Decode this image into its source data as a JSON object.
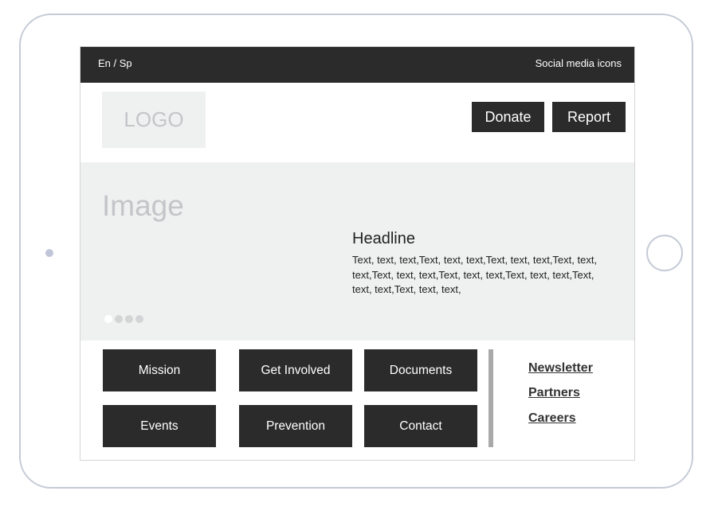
{
  "topbar": {
    "language": "En / Sp",
    "social": "Social media icons"
  },
  "header": {
    "logo": "LOGO",
    "donate_label": "Donate",
    "report_label": "Report"
  },
  "hero": {
    "image_label": "Image",
    "headline": "Headline",
    "body": "Text, text, text,Text, text, text,Text, text, text,Text, text, text,Text, text, text,Text, text, text,Text, text, text,Text, text, text,Text, text, text,",
    "carousel": {
      "count": 4,
      "active_index": 0
    }
  },
  "nav": {
    "mission": "Mission",
    "get_involved": "Get Involved",
    "documents": "Documents",
    "events": "Events",
    "prevention": "Prevention",
    "contact": "Contact"
  },
  "links": {
    "newsletter": "Newsletter",
    "partners": "Partners",
    "careers": "Careers"
  },
  "colors": {
    "dark": "#2b2b2b",
    "placeholder_bg": "#eff0f0",
    "placeholder_text": "#c3c6c8",
    "divider": "#a9a9a9"
  }
}
